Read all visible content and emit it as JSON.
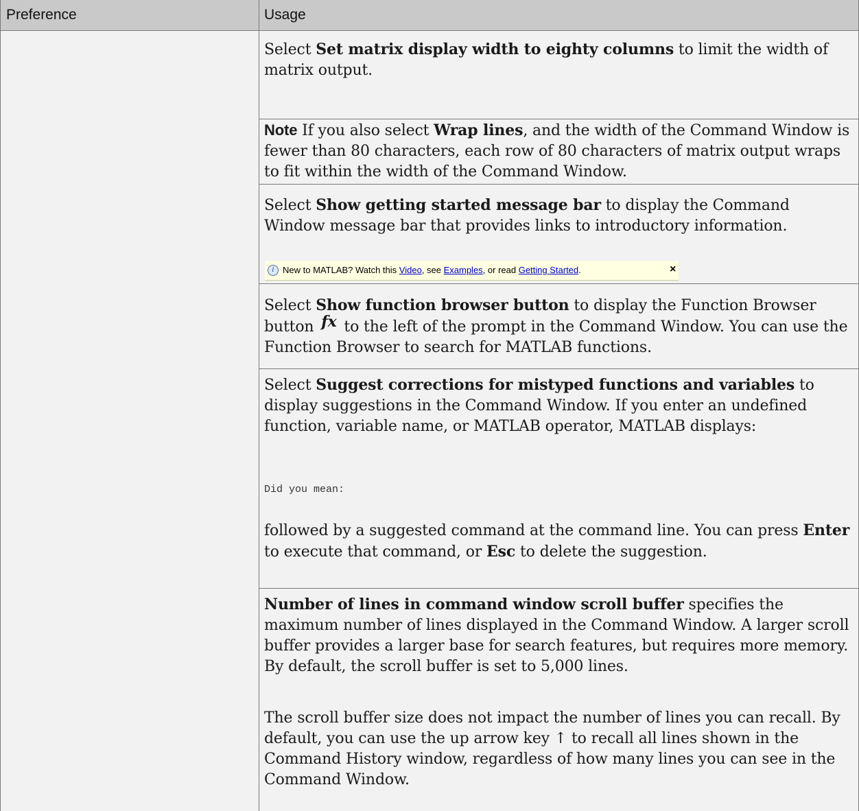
{
  "table": {
    "col_preference": "Preference",
    "col_usage": "Usage"
  },
  "matrix_width": {
    "t1": "Select ",
    "b1": "Set matrix display width to eighty columns",
    "t2": " to limit the width of matrix output."
  },
  "note": {
    "label": "Note",
    "t1": "  If you also select ",
    "b1": "Wrap lines",
    "t2": ", and the width of the Command Window is fewer than 80 characters, each row of 80 characters of matrix output wraps to fit within the width of the Command Window."
  },
  "getting_started": {
    "t1": "Select ",
    "b1": "Show getting started message bar",
    "t2": " to display the Command Window message bar that provides links to introductory information."
  },
  "message_bar": {
    "icon": "info-icon",
    "text1": "New to MATLAB? Watch this ",
    "link_video": "Video",
    "text2": ", see ",
    "link_examples": "Examples",
    "text3": ", or read ",
    "link_getting_started": "Getting Started",
    "text4": ".",
    "close": "×"
  },
  "function_browser": {
    "t1": "Select ",
    "b1": "Show function browser button",
    "t2": " to display the Function Browser button ",
    "icon_glyph": "fx",
    "t3": " to the left of the prompt in the Command Window. You can use the Function Browser to search for MATLAB functions."
  },
  "suggest": {
    "t1": "Select ",
    "b1": "Suggest corrections for mistyped functions and variables",
    "t2": " to display suggestions in the Command Window. If you enter an undefined function, variable name, or MATLAB operator, MATLAB displays:",
    "code": "Did you mean:",
    "f1": "followed by a suggested command at the command line. You can press ",
    "b_enter": "Enter",
    "f2": " to execute that command, or ",
    "b_esc": "Esc",
    "f3": " to delete the suggestion."
  },
  "scroll_buffer": {
    "b1": "Number of lines in command window scroll buffer",
    "t1": " specifies the maximum number of lines displayed in the Command Window. A larger scroll buffer provides a larger base for search features, but requires more memory. By default, the scroll buffer is set to 5,000 lines.",
    "p2": "The scroll buffer size does not impact the number of lines you can recall. By default, you can use the up arrow key ↑ to recall all lines shown in the Command History window, regardless of how many lines you can see in the Command Window."
  }
}
